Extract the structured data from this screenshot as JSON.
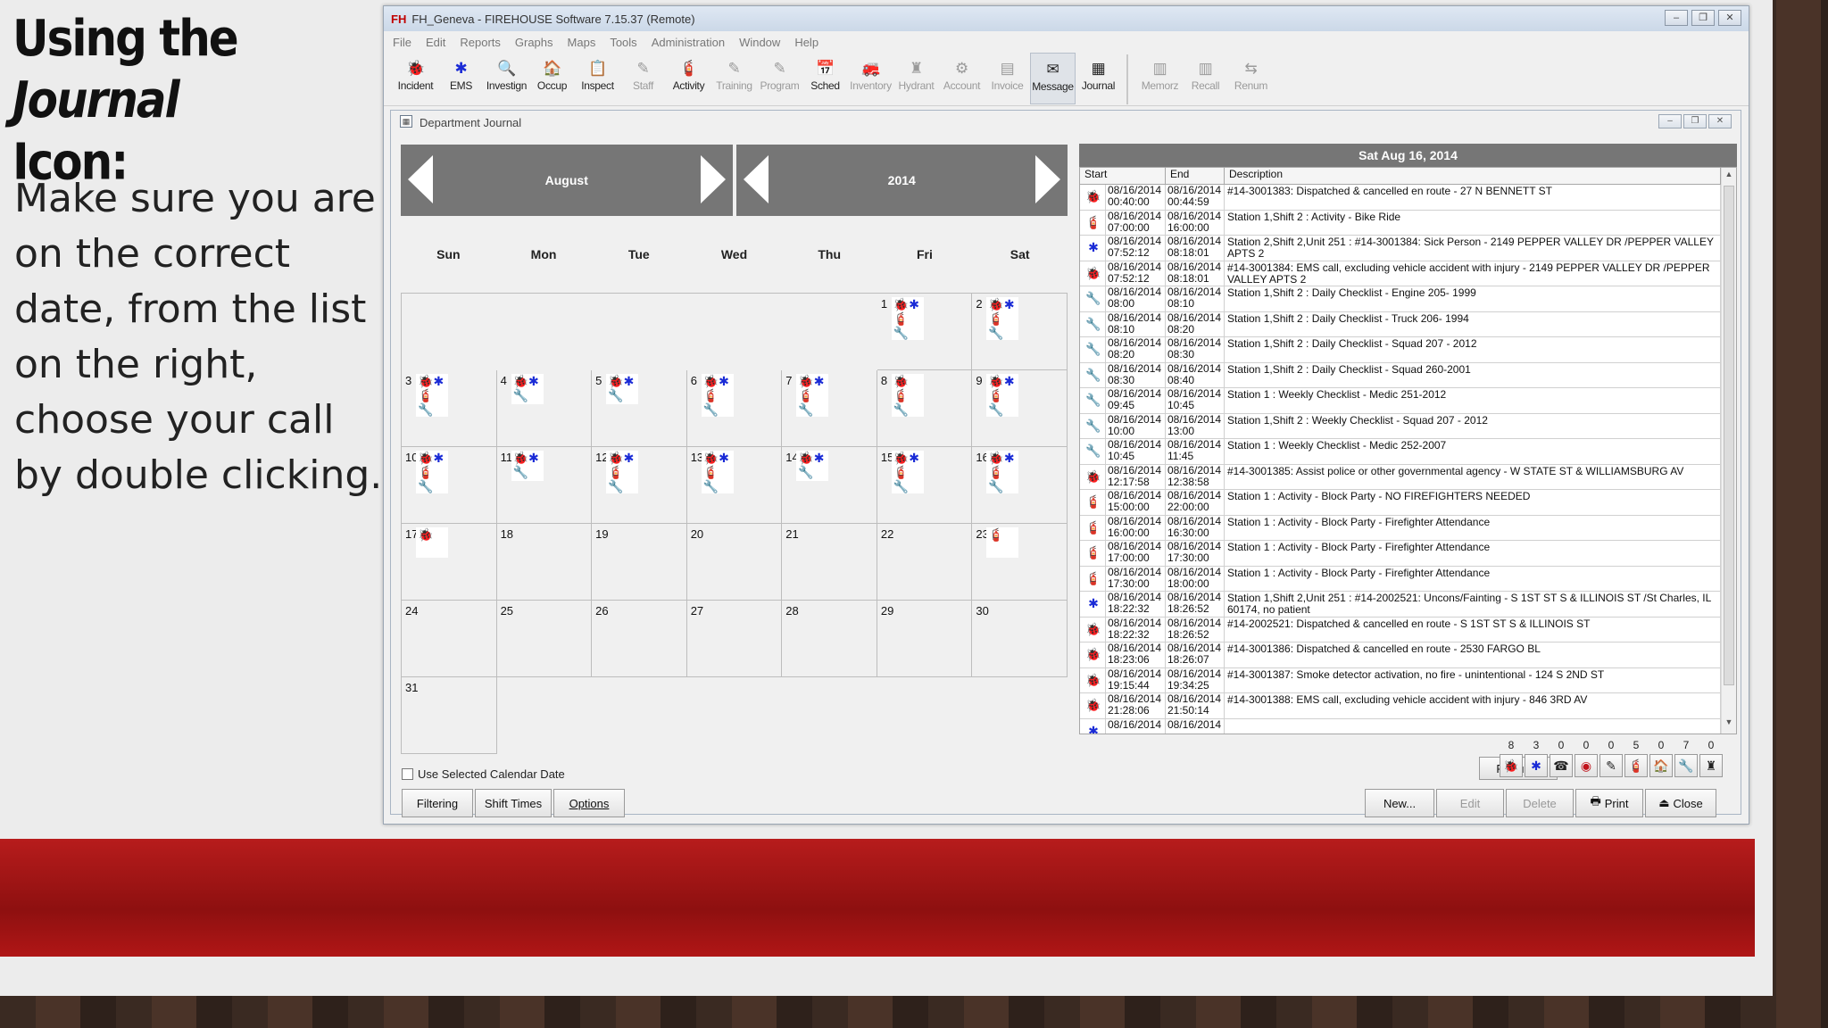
{
  "slide": {
    "title_part1": "Using the ",
    "title_italic": "Journal",
    "title_part2": "Icon:",
    "body": "Make sure you are on the correct date, from the list on the right, choose your call by double clicking."
  },
  "window": {
    "logo": "FH",
    "title": "FH_Geneva - FIREHOUSE Software 7.15.37 (Remote)",
    "menu": [
      "File",
      "Edit",
      "Reports",
      "Graphs",
      "Maps",
      "Tools",
      "Administration",
      "Window",
      "Help"
    ],
    "toolbar": [
      {
        "label": "Incident",
        "icon": "incident-icon",
        "glyph": "🐞",
        "enabled": true
      },
      {
        "label": "EMS",
        "icon": "ems-star-icon",
        "glyph": "✱",
        "enabled": true
      },
      {
        "label": "Investign",
        "icon": "investigation-icon",
        "glyph": "🔍",
        "enabled": true
      },
      {
        "label": "Occup",
        "icon": "occupancy-icon",
        "glyph": "🏠",
        "enabled": true
      },
      {
        "label": "Inspect",
        "icon": "inspect-icon",
        "glyph": "📋",
        "enabled": true
      },
      {
        "label": "Staff",
        "icon": "staff-icon",
        "glyph": "✎",
        "enabled": false
      },
      {
        "label": "Activity",
        "icon": "activity-icon",
        "glyph": "🧯",
        "enabled": true
      },
      {
        "label": "Training",
        "icon": "training-icon",
        "glyph": "✎",
        "enabled": false
      },
      {
        "label": "Program",
        "icon": "program-icon",
        "glyph": "✎",
        "enabled": false
      },
      {
        "label": "Sched",
        "icon": "schedule-icon",
        "glyph": "📅",
        "enabled": true
      },
      {
        "label": "Inventory",
        "icon": "inventory-icon",
        "glyph": "🚒",
        "enabled": false
      },
      {
        "label": "Hydrant",
        "icon": "hydrant-icon",
        "glyph": "♜",
        "enabled": false
      },
      {
        "label": "Account",
        "icon": "account-icon",
        "glyph": "⚙",
        "enabled": false
      },
      {
        "label": "Invoice",
        "icon": "invoice-icon",
        "glyph": "▤",
        "enabled": false
      },
      {
        "label": "Message",
        "icon": "message-icon",
        "glyph": "✉",
        "enabled": true,
        "selected": true
      },
      {
        "label": "Journal",
        "icon": "journal-icon",
        "glyph": "▦",
        "enabled": true
      }
    ],
    "toolbar2": [
      {
        "label": "Memorz",
        "icon": "memorize-icon",
        "glyph": "▥"
      },
      {
        "label": "Recall",
        "icon": "recall-icon",
        "glyph": "▥"
      },
      {
        "label": "Renum",
        "icon": "renumber-icon",
        "glyph": "⇆"
      }
    ]
  },
  "journal": {
    "title": "Department Journal",
    "month": "August",
    "year": "2014",
    "dows": [
      "Sun",
      "Mon",
      "Tue",
      "Wed",
      "Thu",
      "Fri",
      "Sat"
    ],
    "first_weekday": 5,
    "days_in_month": 31,
    "day_icons": {
      "1": [
        "incident",
        "ems",
        "activity",
        "checklist"
      ],
      "2": [
        "incident",
        "ems",
        "activity",
        "checklist"
      ],
      "3": [
        "incident",
        "ems",
        "activity",
        "checklist"
      ],
      "4": [
        "incident",
        "ems",
        "checklist"
      ],
      "5": [
        "incident",
        "ems",
        "checklist"
      ],
      "6": [
        "incident",
        "ems",
        "activity",
        "checklist"
      ],
      "7": [
        "incident",
        "ems",
        "activity",
        "checklist"
      ],
      "8": [
        "incident",
        "activity",
        "checklist"
      ],
      "9": [
        "incident",
        "ems",
        "activity",
        "checklist"
      ],
      "10": [
        "incident",
        "ems",
        "activity",
        "checklist"
      ],
      "11": [
        "incident",
        "ems",
        "checklist"
      ],
      "12": [
        "incident",
        "ems",
        "activity",
        "checklist"
      ],
      "13": [
        "incident",
        "ems",
        "activity",
        "checklist"
      ],
      "14": [
        "incident",
        "ems",
        "checklist"
      ],
      "15": [
        "incident",
        "ems",
        "activity",
        "checklist"
      ],
      "16": [
        "incident",
        "ems",
        "activity",
        "checklist"
      ],
      "17": [
        "incident"
      ],
      "23": [
        "activity"
      ]
    },
    "use_selected_date_label": "Use Selected Calendar Date",
    "buttons_left": [
      "Filtering",
      "Shift Times",
      "Options"
    ],
    "list_header_date": "Sat Aug 16, 2014",
    "columns": [
      "Start",
      "End",
      "Description"
    ],
    "entries": [
      {
        "type": "incident",
        "start": "08/16/2014 00:40:00",
        "end": "08/16/2014 00:44:59",
        "desc": "#14-3001383: Dispatched & cancelled en route - 27 N BENNETT ST"
      },
      {
        "type": "activity",
        "start": "08/16/2014 07:00:00",
        "end": "08/16/2014 16:00:00",
        "desc": "Station 1,Shift 2 : Activity - Bike Ride"
      },
      {
        "type": "ems",
        "start": "08/16/2014 07:52:12",
        "end": "08/16/2014 08:18:01",
        "desc": "Station 2,Shift 2,Unit 251 : #14-3001384: Sick Person - 2149 PEPPER VALLEY DR /PEPPER VALLEY APTS 2"
      },
      {
        "type": "incident",
        "start": "08/16/2014 07:52:12",
        "end": "08/16/2014 08:18:01",
        "desc": "#14-3001384: EMS call, excluding vehicle accident with injury - 2149 PEPPER VALLEY DR /PEPPER VALLEY APTS 2"
      },
      {
        "type": "checklist",
        "start": "08/16/2014 08:00",
        "end": "08/16/2014 08:10",
        "desc": "Station 1,Shift 2 : Daily Checklist - Engine 205- 1999"
      },
      {
        "type": "checklist",
        "start": "08/16/2014 08:10",
        "end": "08/16/2014 08:20",
        "desc": "Station 1,Shift 2 : Daily Checklist - Truck 206- 1994"
      },
      {
        "type": "checklist",
        "start": "08/16/2014 08:20",
        "end": "08/16/2014 08:30",
        "desc": "Station 1,Shift 2 : Daily Checklist - Squad 207 - 2012"
      },
      {
        "type": "checklist",
        "start": "08/16/2014 08:30",
        "end": "08/16/2014 08:40",
        "desc": "Station 1,Shift 2 : Daily Checklist - Squad 260-2001"
      },
      {
        "type": "checklist",
        "start": "08/16/2014 09:45",
        "end": "08/16/2014 10:45",
        "desc": "Station 1 : Weekly Checklist - Medic 251-2012"
      },
      {
        "type": "checklist",
        "start": "08/16/2014 10:00",
        "end": "08/16/2014 13:00",
        "desc": "Station 1,Shift 2 : Weekly Checklist - Squad 207 - 2012"
      },
      {
        "type": "checklist",
        "start": "08/16/2014 10:45",
        "end": "08/16/2014 11:45",
        "desc": "Station 1 : Weekly Checklist - Medic 252-2007"
      },
      {
        "type": "incident",
        "start": "08/16/2014 12:17:58",
        "end": "08/16/2014 12:38:58",
        "desc": "#14-3001385: Assist police or other governmental agency - W STATE ST & WILLIAMSBURG AV"
      },
      {
        "type": "activity",
        "start": "08/16/2014 15:00:00",
        "end": "08/16/2014 22:00:00",
        "desc": "Station 1 : Activity - Block Party - NO FIREFIGHTERS NEEDED"
      },
      {
        "type": "activity",
        "start": "08/16/2014 16:00:00",
        "end": "08/16/2014 16:30:00",
        "desc": "Station 1 : Activity - Block Party - Firefighter Attendance"
      },
      {
        "type": "activity",
        "start": "08/16/2014 17:00:00",
        "end": "08/16/2014 17:30:00",
        "desc": "Station 1 : Activity - Block Party - Firefighter Attendance"
      },
      {
        "type": "activity",
        "start": "08/16/2014 17:30:00",
        "end": "08/16/2014 18:00:00",
        "desc": "Station 1 : Activity - Block Party - Firefighter Attendance"
      },
      {
        "type": "ems",
        "start": "08/16/2014 18:22:32",
        "end": "08/16/2014 18:26:52",
        "desc": "Station 1,Shift 2,Unit 251 : #14-2002521: Uncons/Fainting - S 1ST ST S & ILLINOIS ST /St Charles, IL 60174, no patient"
      },
      {
        "type": "incident",
        "start": "08/16/2014 18:22:32",
        "end": "08/16/2014 18:26:52",
        "desc": "#14-2002521: Dispatched & cancelled en route - S 1ST ST S & ILLINOIS ST"
      },
      {
        "type": "incident",
        "start": "08/16/2014 18:23:06",
        "end": "08/16/2014 18:26:07",
        "desc": "#14-3001386: Dispatched & cancelled en route - 2530 FARGO BL"
      },
      {
        "type": "incident",
        "start": "08/16/2014 19:15:44",
        "end": "08/16/2014 19:34:25",
        "desc": "#14-3001387: Smoke detector activation, no fire - unintentional - 124 S 2ND ST"
      },
      {
        "type": "incident",
        "start": "08/16/2014 21:28:06",
        "end": "08/16/2014 21:50:14",
        "desc": "#14-3001388: EMS call, excluding vehicle accident with injury - 846 3RD AV"
      },
      {
        "type": "ems",
        "start": "08/16/2014",
        "end": "08/16/2014",
        "desc": ""
      }
    ],
    "requery_label": "Requery",
    "counters": [
      {
        "count": "8",
        "icon": "incident-counter-icon",
        "glyph": "🐞"
      },
      {
        "count": "3",
        "icon": "ems-counter-icon",
        "glyph": "✱"
      },
      {
        "count": "0",
        "icon": "phone-counter-icon",
        "glyph": "☎"
      },
      {
        "count": "0",
        "icon": "alarm-counter-icon",
        "glyph": "◉"
      },
      {
        "count": "0",
        "icon": "pen-counter-icon",
        "glyph": "✎"
      },
      {
        "count": "5",
        "icon": "activity-counter-icon",
        "glyph": "🧯"
      },
      {
        "count": "0",
        "icon": "occupancy-counter-icon",
        "glyph": "🏠"
      },
      {
        "count": "7",
        "icon": "checklist-counter-icon",
        "glyph": "🔧"
      },
      {
        "count": "0",
        "icon": "hydrant-counter-icon",
        "glyph": "♜"
      }
    ],
    "buttons_right": [
      {
        "label": "New...",
        "enabled": true
      },
      {
        "label": "Edit",
        "enabled": false
      },
      {
        "label": "Delete",
        "enabled": false
      },
      {
        "label": "Print",
        "enabled": true,
        "icon": "printer-icon",
        "glyph": "🖶"
      },
      {
        "label": "Close",
        "enabled": true,
        "icon": "close-door-icon",
        "glyph": "⏏"
      }
    ]
  },
  "colors": {
    "accent_red": "#b71c1c",
    "nav_gray": "#767676",
    "incident": "#c0141c",
    "ems": "#1a2bd6"
  }
}
